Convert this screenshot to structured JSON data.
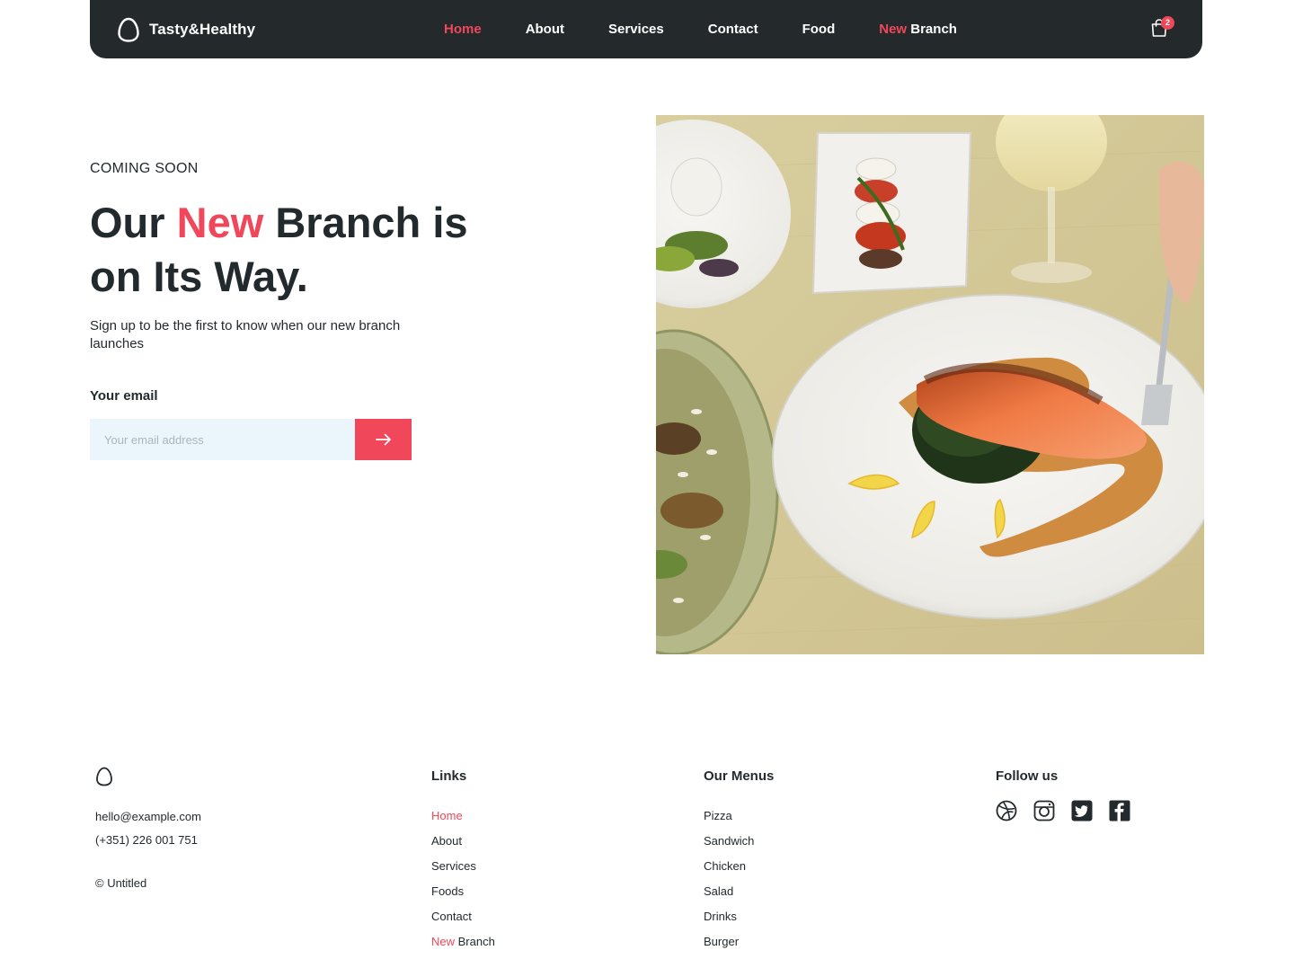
{
  "brand": {
    "name": "Tasty&Healthy"
  },
  "nav": {
    "items": [
      {
        "label": "Home",
        "active": true
      },
      {
        "label": "About"
      },
      {
        "label": "Services"
      },
      {
        "label": "Contact"
      },
      {
        "label": "Food"
      }
    ],
    "branch": {
      "accent": "New",
      "rest": "Branch"
    }
  },
  "cart": {
    "count": "2"
  },
  "hero": {
    "eyebrow": "COMING SOON",
    "title_part1": "Our",
    "title_accent": "New",
    "title_part2": "Branch is on Its Way.",
    "subtitle": "Sign up to be the first to know when our new branch launches",
    "email_label": "Your email",
    "email_placeholder": "Your email address",
    "email_value": ""
  },
  "footer": {
    "email": "hello@example.com",
    "phone": "(+351) 226 001 751",
    "copyright": "© Untitled",
    "links_title": "Links",
    "links": [
      "Home",
      "About",
      "Services",
      "Foods",
      "Contact"
    ],
    "links_branch": {
      "accent": "New",
      "rest": "Branch"
    },
    "menus_title": "Our Menus",
    "menus": [
      "Pizza",
      "Sandwich",
      "Chicken",
      "Salad",
      "Drinks",
      "Burger"
    ],
    "follow_title": "Follow us",
    "social_icons": [
      "dribbble-icon",
      "instagram-icon",
      "twitter-icon",
      "facebook-icon"
    ]
  },
  "colors": {
    "accent": "#f0475a",
    "dark": "#24292c",
    "input_bg": "#eaf6fb"
  }
}
